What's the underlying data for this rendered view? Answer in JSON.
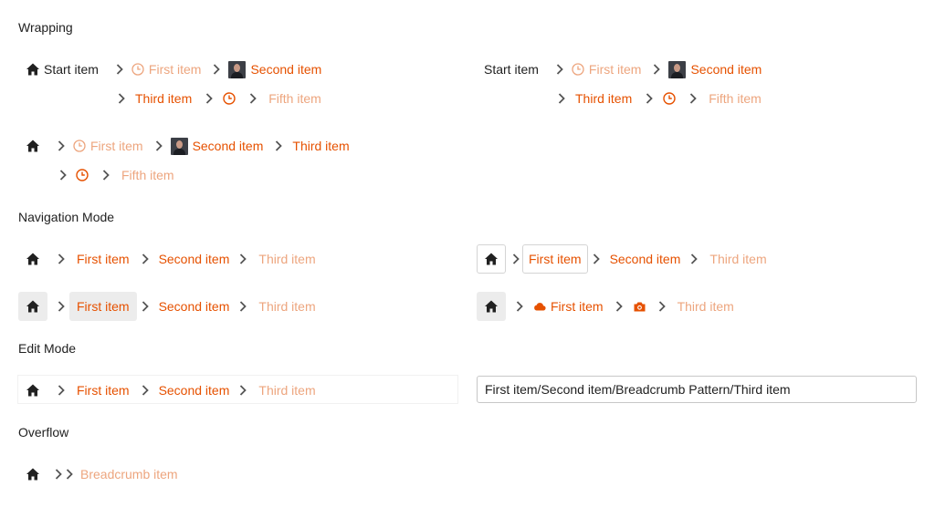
{
  "sections": {
    "wrapping": "Wrapping",
    "navigation": "Navigation Mode",
    "edit": "Edit Mode",
    "overflow": "Overflow"
  },
  "wrap_a": {
    "start": "Start item",
    "first": "First item",
    "second": "Second item",
    "third": "Third item",
    "fifth": "Fifth item"
  },
  "wrap_b": {
    "start": "Start item",
    "first": "First item",
    "second": "Second item",
    "third": "Third item",
    "fifth": "Fifth item"
  },
  "wrap_c": {
    "first": "First item",
    "second": "Second item",
    "third": "Third item",
    "fifth": "Fifth item"
  },
  "nav_1": {
    "first": "First item",
    "second": "Second item",
    "third": "Third item"
  },
  "nav_2": {
    "first": "First item",
    "second": "Second item",
    "third": "Third item"
  },
  "nav_3": {
    "first": "First item",
    "second": "Second item",
    "third": "Third item"
  },
  "nav_4": {
    "first": "First item",
    "third": "Third item"
  },
  "edit": {
    "first": "First item",
    "second": "Second item",
    "third": "Third item",
    "input_value": "First item/Second item/Breadcrumb Pattern/Third item"
  },
  "overflow": {
    "item": "Breadcrumb item"
  },
  "colors": {
    "link": "#e65100",
    "link_dim": "#eda57e",
    "text": "#212121"
  }
}
